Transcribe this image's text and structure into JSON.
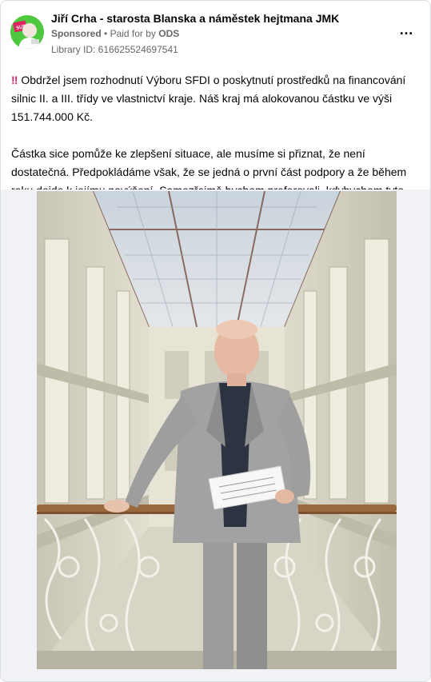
{
  "ad": {
    "page_name": "Jiří Crha - starosta Blanska a náměstek hejtmana JMK",
    "sponsored_label": "Sponsored",
    "paid_for_by_prefix": "Paid for by",
    "paid_for_by_name": "ODS",
    "separator": "•",
    "library_id": "Library ID: 616625524697541",
    "more_icon": "…",
    "paragraph_1": "Obdržel jsem rozhodnutí Výboru SFDI o poskytnutí prostředků na financování silnic II. a III. třídy ve vlastnictví kraje. Náš kraj má alokovanou částku ve výši 151.744.000 Kč.",
    "paragraph_2": "Částka sice pomůže ke zlepšení situace, ale musíme si přiznat, že není dostatečná. Předpokládáme však, že se jedná o první část podpory a že během roku dojde k jejímu navýšení. Samozřejmě bychom preferovali, kdybychom tyto…",
    "exclamation_icon": "‼",
    "avatar_badge_text": "SUPER"
  },
  "colors": {
    "avatar_bg": "#4ec83f",
    "avatar_badge": "#e0245e",
    "exclamation": "#e0245e",
    "muted_text": "#65676b"
  }
}
